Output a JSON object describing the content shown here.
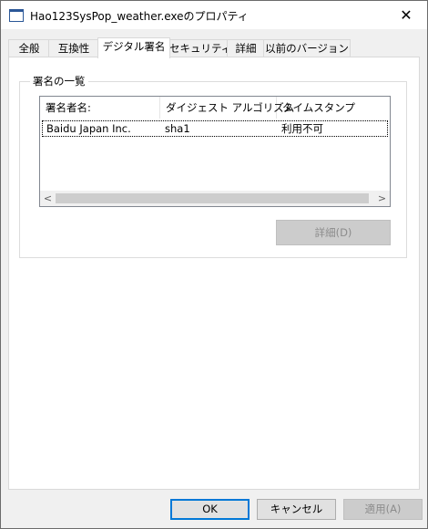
{
  "window": {
    "title": "Hao123SysPop_weather.exeのプロパティ",
    "close_glyph": "✕"
  },
  "tabs": [
    {
      "label": "全般"
    },
    {
      "label": "互換性"
    },
    {
      "label": "デジタル署名",
      "active": true
    },
    {
      "label": "セキュリティ"
    },
    {
      "label": "詳細"
    },
    {
      "label": "以前のバージョン"
    }
  ],
  "signatures": {
    "group_label": "署名の一覧",
    "columns": [
      "署名者名:",
      "ダイジェスト アルゴリズム",
      "タイムスタンプ"
    ],
    "rows": [
      [
        "Baidu Japan Inc.",
        "sha1",
        "利用不可"
      ]
    ],
    "scroll_left": "<",
    "scroll_right": ">"
  },
  "details_button": "詳細(D)",
  "footer": {
    "ok": "OK",
    "cancel": "キャンセル",
    "apply": "適用(A)"
  },
  "colors": {
    "focus": "#0078d7",
    "disabled_bg": "#cccccc"
  }
}
